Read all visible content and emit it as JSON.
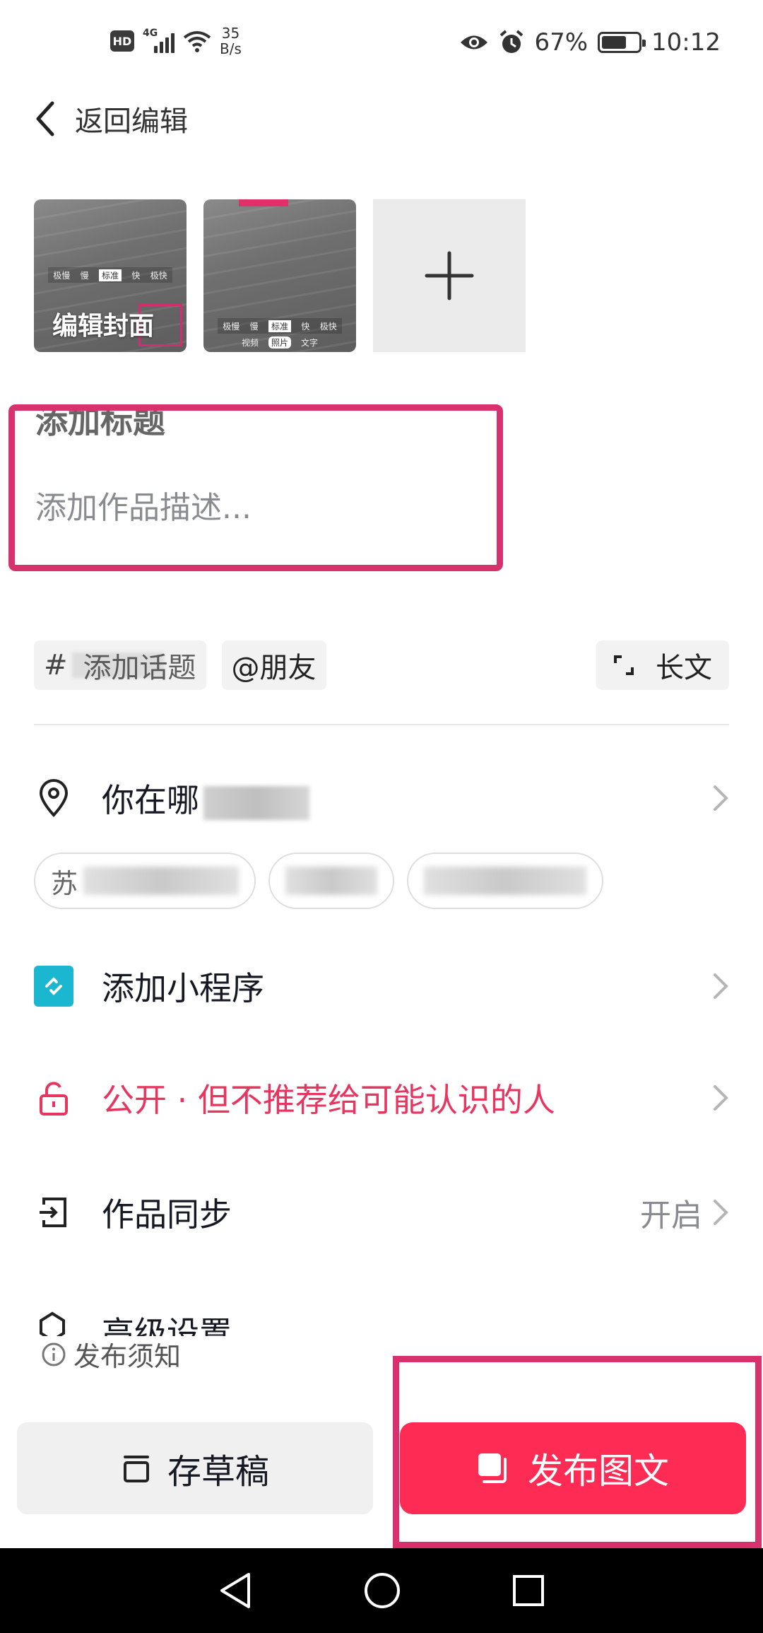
{
  "status_bar": {
    "hd": "HD",
    "network": "4G",
    "net_speed_value": "35",
    "net_speed_unit": "B/s",
    "battery_percent_text": "67%",
    "battery_level": 0.67,
    "time": "10:12"
  },
  "header": {
    "back_label": "返回编辑"
  },
  "thumbnails": {
    "cover_label": "编辑封面",
    "mode_left": [
      "极慢",
      "慢",
      "标准",
      "快",
      "极快"
    ],
    "tabs": [
      "视频",
      "照片",
      "文字"
    ]
  },
  "editor": {
    "title_placeholder": "添加标题",
    "description_placeholder": "添加作品描述..."
  },
  "chips": {
    "topic_prefix": "#",
    "topic_suffix": "添加话题",
    "mention": "@朋友",
    "long_text": "长文"
  },
  "location": {
    "label_prefix": "你在哪",
    "suggestion_prefix": "苏"
  },
  "rows": {
    "mini_program": "添加小程序",
    "privacy": "公开 · 但不推荐给可能认识的人",
    "sync": "作品同步",
    "sync_value": "开启",
    "advanced": "高级设置"
  },
  "footer": {
    "notice": "发布须知",
    "draft_label": "存草稿",
    "publish_label": "发布图文"
  },
  "colors": {
    "accent": "#fe2c55",
    "privacy_red": "#e8355f",
    "annotation_pink": "#d7326e",
    "mini_program_teal": "#1bb6cf"
  }
}
